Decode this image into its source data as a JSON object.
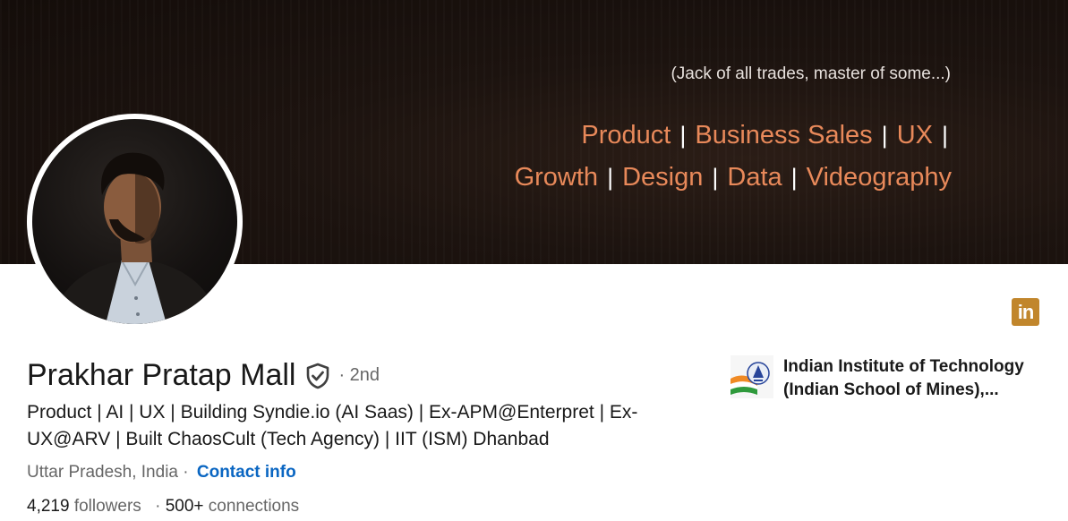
{
  "banner": {
    "tagline": "(Jack of all trades, master of some...)",
    "line1": [
      "Product",
      "Business Sales",
      "UX"
    ],
    "line2": [
      "Growth",
      "Design",
      "Data",
      "Videography"
    ],
    "separator": "|",
    "accent_color": "#e8895a"
  },
  "profile": {
    "name": "Prakhar Pratap Mall",
    "degree": "· 2nd",
    "headline": "Product | AI | UX | Building Syndie.io (AI Saas) | Ex-APM@Enterpret | Ex-UX@ARV | Built ChaosCult (Tech Agency) | IIT (ISM) Dhanbad",
    "location": "Uttar Pradesh, India ·",
    "contact_label": "Contact info",
    "followers_count": "4,219",
    "followers_label": "followers",
    "connections_sep": "·",
    "connections_count": "500+",
    "connections_label": "connections"
  },
  "education": {
    "school_name": "Indian Institute of Technology (Indian School of Mines),..."
  },
  "icons": {
    "linkedin_badge": "in",
    "verified": "shield-check-icon"
  },
  "colors": {
    "link": "#0a66c2",
    "linkedin_badge": "#c1862c"
  }
}
